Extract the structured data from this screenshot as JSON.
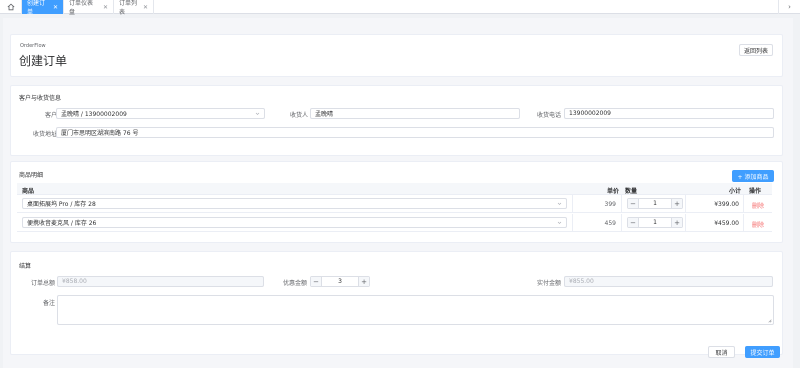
{
  "tabs": [
    {
      "label": "创建订单",
      "active": true
    },
    {
      "label": "订单仪表盘",
      "active": false
    },
    {
      "label": "订单列表",
      "active": false
    }
  ],
  "header": {
    "subtitle": "OrderFlow",
    "title": "创建订单",
    "back_label": "返回列表"
  },
  "customer_section": {
    "title": "客户与收货信息",
    "customer_label": "客户",
    "customer_value": "孟晚晴 / 13900002009",
    "recipient_label": "收货人",
    "recipient_value": "孟晚晴",
    "phone_label": "收货电话",
    "phone_value": "13900002009",
    "address_label": "收货地址",
    "address_value": "厦门市思明区湖滨南路 76 号"
  },
  "items_section": {
    "title": "商品明细",
    "add_label": "+ 添加商品",
    "columns": {
      "product": "商品",
      "price": "单价",
      "qty": "数量",
      "subtotal": "小计",
      "action": "操作"
    },
    "rows": [
      {
        "product": "桌面拓展坞 Pro / 库存 28",
        "price": "399",
        "qty": "1",
        "subtotal": "¥399.00",
        "action": "删除"
      },
      {
        "product": "便携收音麦克风 / 库存 26",
        "price": "459",
        "qty": "1",
        "subtotal": "¥459.00",
        "action": "删除"
      }
    ]
  },
  "settlement": {
    "title": "结算",
    "total_label": "订单总额",
    "total_value": "¥858.00",
    "discount_label": "优惠金额",
    "discount_value": "3",
    "paid_label": "实付金额",
    "paid_value": "¥855.00",
    "remark_label": "备注"
  },
  "footer": {
    "cancel_label": "取消",
    "submit_label": "提交订单"
  },
  "colors": {
    "primary": "#409eff",
    "danger": "#f56c6c"
  }
}
